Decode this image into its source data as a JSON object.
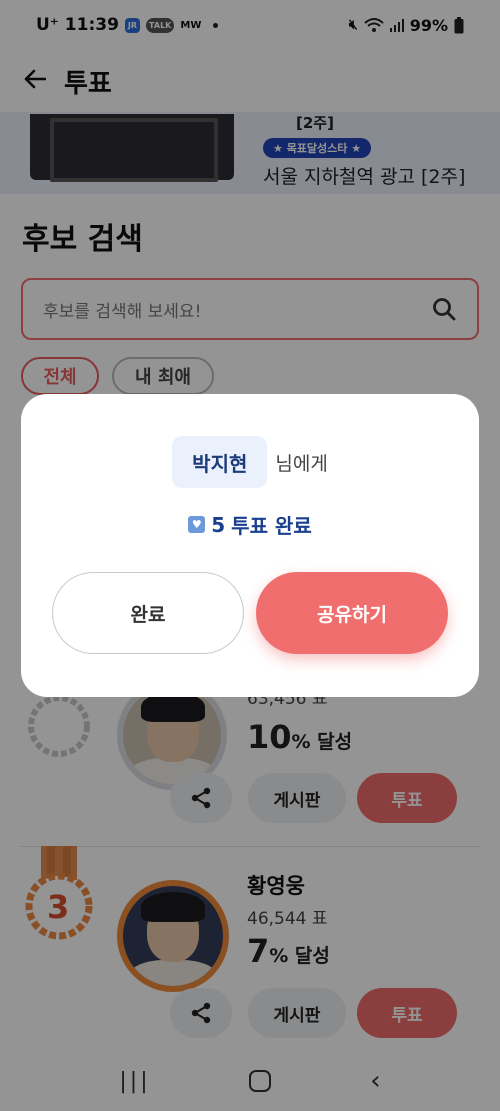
{
  "status_bar": {
    "carrier": "U⁺",
    "time": "11:39",
    "badges": [
      "JR",
      "TALK",
      "MW"
    ],
    "battery": "99%",
    "icons": [
      "mute-icon",
      "wifi-icon",
      "signal-icon",
      "battery-icon"
    ]
  },
  "header": {
    "back_icon": "back-arrow-icon",
    "title": "투표"
  },
  "banner": {
    "top_text": "[2주]",
    "chip_label": "★ 목표달성스타 ★",
    "title": "서울 지하철역 광고 [2주]"
  },
  "search": {
    "section_title": "후보 검색",
    "placeholder": "후보를 검색해 보세요!",
    "filters": [
      "전체",
      "내 최애"
    ]
  },
  "candidates": [
    {
      "votes_text": "63,456 표",
      "percent": "10",
      "percent_suffix": "% 달성",
      "board_label": "게시판",
      "vote_label": "투표"
    },
    {
      "rank": "3",
      "name": "황영웅",
      "votes_text": "46,544 표",
      "percent": "7",
      "percent_suffix": "% 달성",
      "board_label": "게시판",
      "vote_label": "투표"
    }
  ],
  "modal": {
    "name": "박지현",
    "name_suffix": "님에게",
    "result_count": "5",
    "result_text": "투표 완료",
    "done_label": "완료",
    "share_label": "공유하기"
  },
  "colors": {
    "accent": "#ef6b6b",
    "chip_blue": "#1f46b8",
    "name_bg": "#eaf1fc"
  }
}
